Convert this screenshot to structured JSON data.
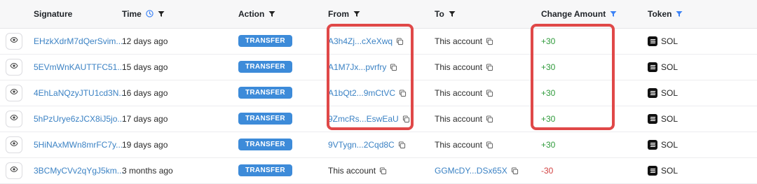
{
  "columns": {
    "signature": "Signature",
    "time": "Time",
    "action": "Action",
    "from": "From",
    "to": "To",
    "change_amount": "Change Amount",
    "token": "Token"
  },
  "rows": [
    {
      "signature": "EHzkXdrM7dQerSvim...",
      "time": "12 days ago",
      "action": "TRANSFER",
      "from": "A3h4Zj...cXeXwq",
      "to": "This account",
      "amount": "+30",
      "token": "SOL"
    },
    {
      "signature": "5EVmWnKAUTTFC51...",
      "time": "15 days ago",
      "action": "TRANSFER",
      "from": "A1M7Jx...pvrfry",
      "to": "This account",
      "amount": "+30",
      "token": "SOL"
    },
    {
      "signature": "4EhLaNQzyJTU1cd3N...",
      "time": "16 days ago",
      "action": "TRANSFER",
      "from": "A1bQt2...9mCtVC",
      "to": "This account",
      "amount": "+30",
      "token": "SOL"
    },
    {
      "signature": "5hPzUrye6zJCX8iJ5jo...",
      "time": "17 days ago",
      "action": "TRANSFER",
      "from": "9ZmcRs...EswEaU",
      "to": "This account",
      "amount": "+30",
      "token": "SOL"
    },
    {
      "signature": "5HiNAxMWn8mrFC7y...",
      "time": "19 days ago",
      "action": "TRANSFER",
      "from": "9VTygn...2Cqd8C",
      "to": "This account",
      "amount": "+30",
      "token": "SOL"
    },
    {
      "signature": "3BCMyCVv2qYgJ5km...",
      "time": "3 months ago",
      "action": "TRANSFER",
      "from": "This account",
      "to": "GGMcDY...DSx65X",
      "amount": "-30",
      "token": "SOL"
    }
  ],
  "colors": {
    "link": "#3b82c4",
    "badge": "#3d8bd9",
    "positive": "#2e9a3a",
    "negative": "#d24141",
    "highlight": "#e04848",
    "filter_active": "#3b82f6"
  },
  "icons": {
    "view": "eye-icon",
    "copy": "copy-icon",
    "filter": "filter-icon",
    "time": "clock-icon",
    "token": "sol-logo-icon"
  }
}
